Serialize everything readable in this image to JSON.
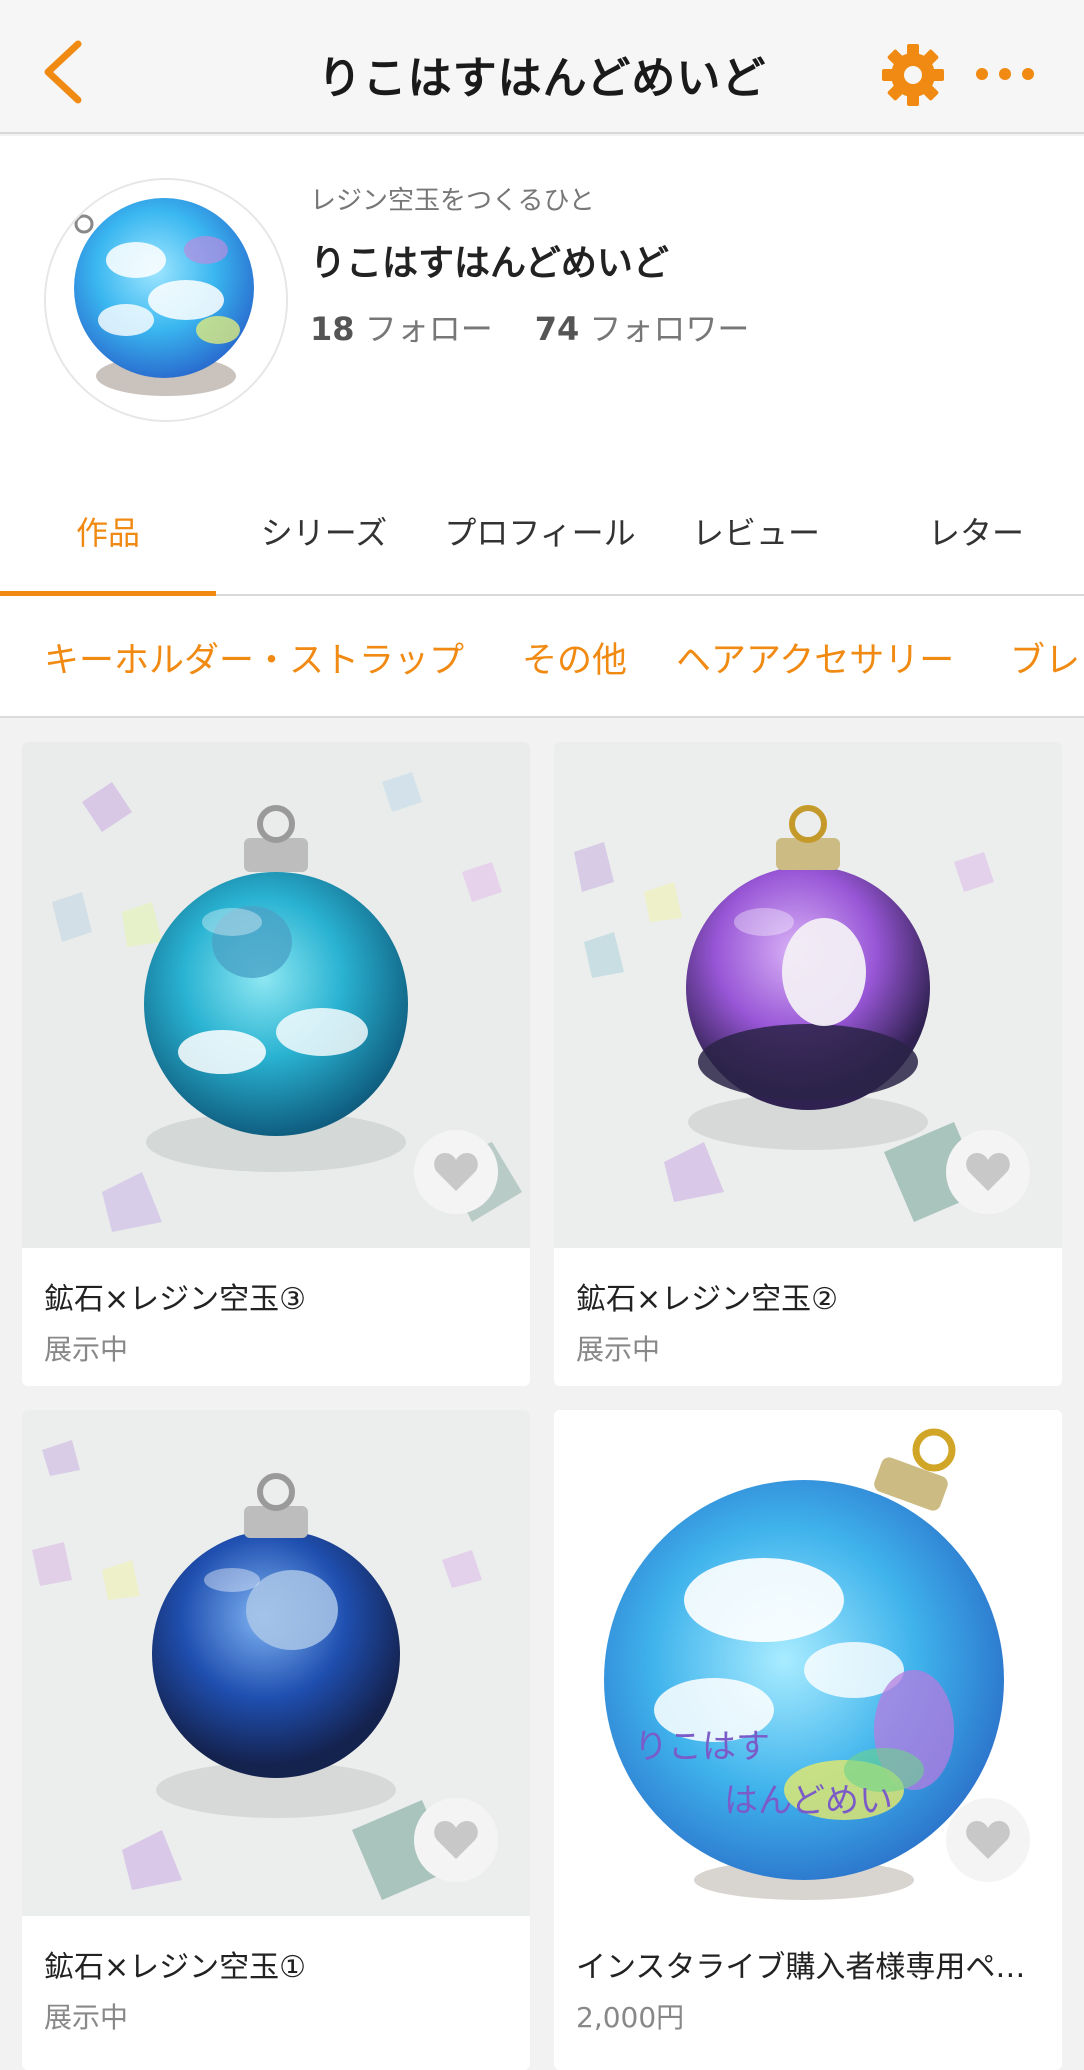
{
  "header": {
    "title": "りこはすはんどめいど",
    "back_icon": "chevron-left-icon",
    "settings_icon": "gear-icon",
    "more_icon": "more-dots-icon",
    "accent_color": "#f08a12"
  },
  "profile": {
    "tagline": "レジン空玉をつくるひと",
    "name": "りこはすはんどめいど",
    "follow_count": "18",
    "follow_label": "フォロー",
    "follower_count": "74",
    "follower_label": "フォロワー"
  },
  "tabs": [
    {
      "label": "作品",
      "active": true
    },
    {
      "label": "シリーズ",
      "active": false
    },
    {
      "label": "プロフィール",
      "active": false
    },
    {
      "label": "レビュー",
      "active": false
    },
    {
      "label": "レター",
      "active": false
    }
  ],
  "categories": [
    {
      "label": "キーホルダー・ストラップ"
    },
    {
      "label": "その他"
    },
    {
      "label": "ヘアアクセサリー"
    },
    {
      "label": "ブレ"
    }
  ],
  "products": [
    {
      "title": "鉱石×レジン空玉③",
      "status": "展示中",
      "image": "teal-resin-orb-photo"
    },
    {
      "title": "鉱石×レジン空玉②",
      "status": "展示中",
      "image": "purple-resin-orb-photo"
    },
    {
      "title": "鉱石×レジン空玉①",
      "status": "展示中",
      "image": "blue-resin-orb-photo"
    },
    {
      "title": "インスタライブ購入者様専用ペ…",
      "status": "2,000円",
      "image": "sky-resin-orb-photo",
      "watermark_line1": "りこはす",
      "watermark_line2": "はんどめい"
    }
  ]
}
